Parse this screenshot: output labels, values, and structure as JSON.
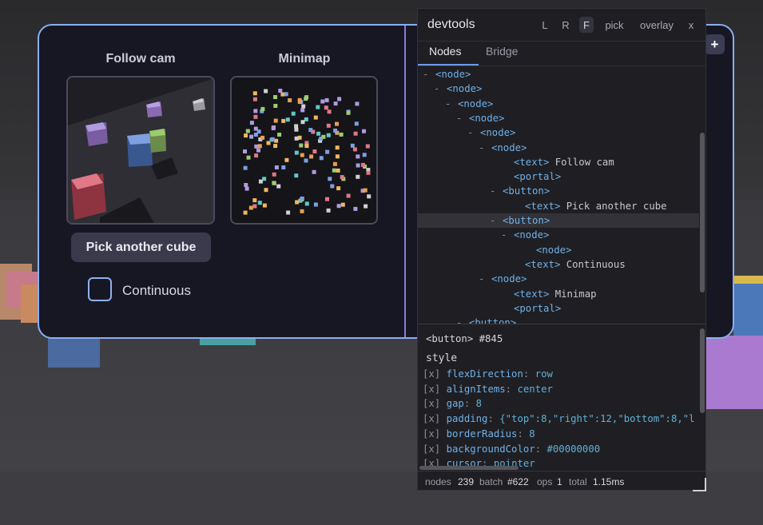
{
  "panel": {
    "follow_cam_title": "Follow cam",
    "minimap_title": "Minimap",
    "pick_button_label": "Pick another cube",
    "continuous_label": "Continuous",
    "continuous_checked": false,
    "plus_button_label": "+"
  },
  "devtools": {
    "title": "devtools",
    "header_buttons": {
      "left": "L",
      "right": "R",
      "float": "F",
      "pick": "pick",
      "overlay": "overlay",
      "close": "x"
    },
    "active_header_button": "F",
    "tabs": {
      "nodes": "Nodes",
      "bridge": "Bridge"
    },
    "active_tab": "Nodes",
    "tree": [
      {
        "dash": "-",
        "tag": "<node>",
        "text": ""
      },
      {
        "dash": "-",
        "tag": "<node>",
        "text": ""
      },
      {
        "dash": "-",
        "tag": "<node>",
        "text": ""
      },
      {
        "dash": "-",
        "tag": "<node>",
        "text": ""
      },
      {
        "dash": "-",
        "tag": "<node>",
        "text": ""
      },
      {
        "dash": "-",
        "tag": "<node>",
        "text": ""
      },
      {
        "dash": "",
        "tag": "<text>",
        "text": "Follow cam"
      },
      {
        "dash": "",
        "tag": "<portal>",
        "text": ""
      },
      {
        "dash": "-",
        "tag": "<button>",
        "text": ""
      },
      {
        "dash": "",
        "tag": "<text>",
        "text": "Pick another cube"
      },
      {
        "dash": "-",
        "tag": "<button>",
        "text": "",
        "selected": true
      },
      {
        "dash": "-",
        "tag": "<node>",
        "text": ""
      },
      {
        "dash": "",
        "tag": "<node>",
        "text": ""
      },
      {
        "dash": "",
        "tag": "<text>",
        "text": "Continuous"
      },
      {
        "dash": "-",
        "tag": "<node>",
        "text": ""
      },
      {
        "dash": "",
        "tag": "<text>",
        "text": "Minimap"
      },
      {
        "dash": "",
        "tag": "<portal>",
        "text": ""
      },
      {
        "dash": "-",
        "tag": "<button>",
        "text": ""
      }
    ],
    "selected": {
      "heading": "<button> #845",
      "section": "style",
      "props": [
        {
          "mark": "[x]",
          "key": "flexDirection",
          "value": "row"
        },
        {
          "mark": "[x]",
          "key": "alignItems",
          "value": "center"
        },
        {
          "mark": "[x]",
          "key": "gap",
          "value": "8"
        },
        {
          "mark": "[x]",
          "key": "padding",
          "value": "{\"top\":8,\"right\":12,\"bottom\":8,\"l"
        },
        {
          "mark": "[x]",
          "key": "borderRadius",
          "value": "8"
        },
        {
          "mark": "[x]",
          "key": "backgroundColor",
          "value": "#00000000"
        },
        {
          "mark": "[x]",
          "key": "cursor",
          "value": "pointer"
        }
      ]
    },
    "status": {
      "nodes_label": "nodes",
      "nodes_value": "239",
      "batch_label": "batch",
      "batch_value": "#622",
      "ops_label": "ops",
      "ops_value": "1",
      "total_label": "total",
      "total_value": "1.15ms"
    }
  },
  "colors": {
    "panel_border": "#8aaef0",
    "panel_divider": "#8f7bd0",
    "tag": "#6fb0e8",
    "tab_underline": "#6f9ae8"
  }
}
